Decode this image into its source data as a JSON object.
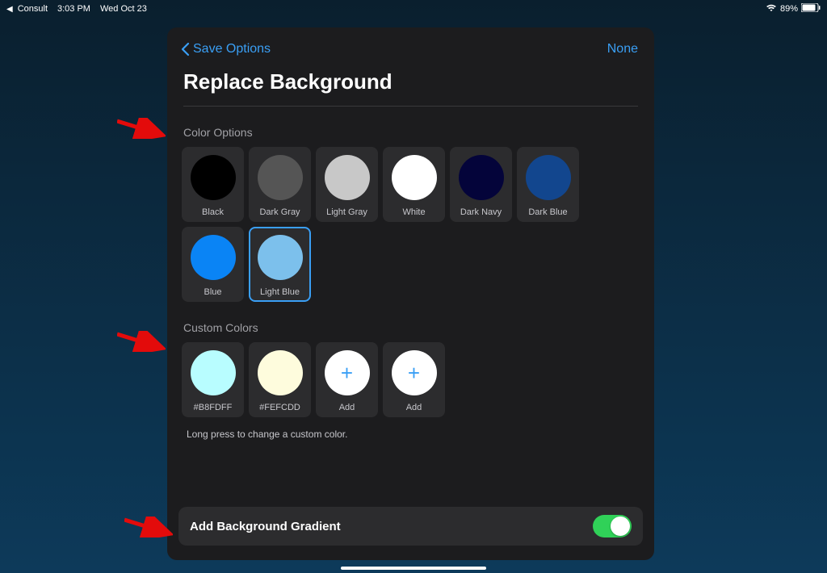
{
  "statusBar": {
    "appName": "Consult",
    "time": "3:03 PM",
    "date": "Wed Oct 23",
    "batteryPct": "89%"
  },
  "panel": {
    "backLabel": "Save Options",
    "noneLabel": "None",
    "title": "Replace Background",
    "colorOptionsLabel": "Color Options",
    "colorOptions": [
      {
        "label": "Black",
        "color": "#000000",
        "selected": false
      },
      {
        "label": "Dark Gray",
        "color": "#555555",
        "selected": false
      },
      {
        "label": "Light Gray",
        "color": "#c8c8c8",
        "selected": false
      },
      {
        "label": "White",
        "color": "#ffffff",
        "selected": false
      },
      {
        "label": "Dark Navy",
        "color": "#04043a",
        "selected": false
      },
      {
        "label": "Dark Blue",
        "color": "#12468e",
        "selected": false
      },
      {
        "label": "Blue",
        "color": "#0a84f5",
        "selected": false
      },
      {
        "label": "Light Blue",
        "color": "#7cc0ec",
        "selected": true
      }
    ],
    "customColorsLabel": "Custom Colors",
    "customColors": [
      {
        "label": "#B8FDFF",
        "color": "#B8FDFF",
        "isAdd": false
      },
      {
        "label": "#FEFCDD",
        "color": "#FEFCDD",
        "isAdd": false
      },
      {
        "label": "Add",
        "color": "#ffffff",
        "isAdd": true
      },
      {
        "label": "Add",
        "color": "#ffffff",
        "isAdd": true
      }
    ],
    "customHint": "Long press to change a custom color.",
    "gradientToggleLabel": "Add Background Gradient",
    "gradientToggleOn": true
  }
}
